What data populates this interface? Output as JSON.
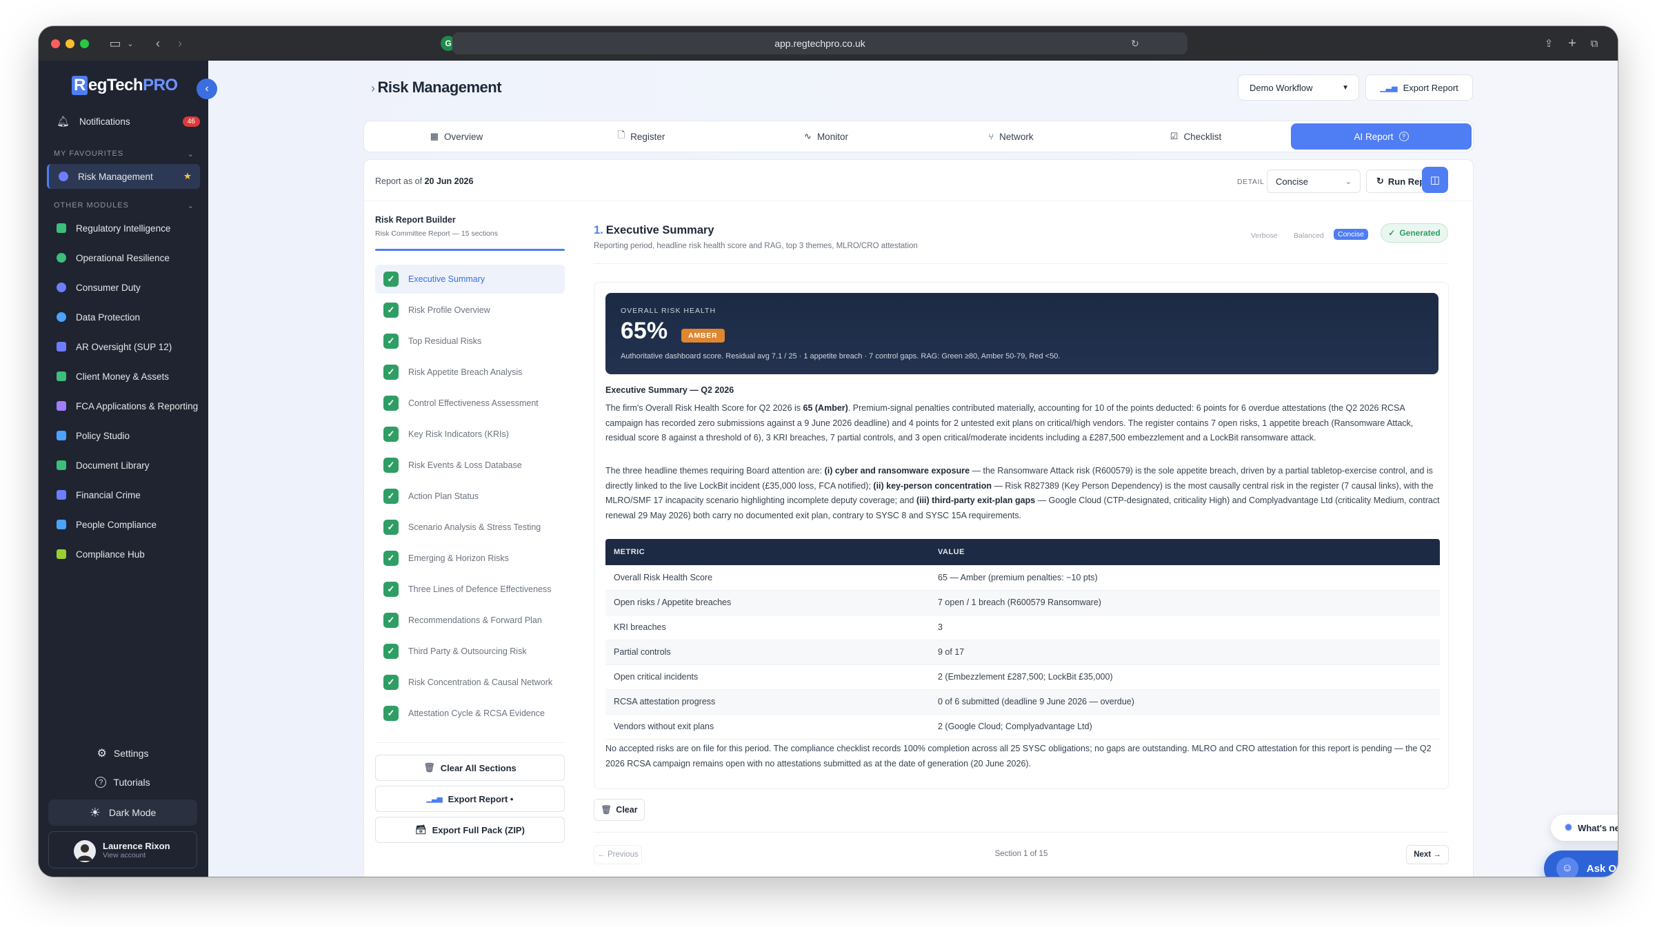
{
  "browser": {
    "url": "app.regtechpro.co.uk"
  },
  "sidebar": {
    "logo_main": "egTech",
    "logo_r": "R",
    "logo_pro": "PRO",
    "notifications_label": "Notifications",
    "notifications_count": "46",
    "favourites_header": "MY FAVOURITES",
    "favourite_item": "Risk Management",
    "favourite_star": "★",
    "other_header": "OTHER MODULES",
    "modules": [
      {
        "label": "Regulatory Intelligence",
        "color": "#3bbf7a"
      },
      {
        "label": "Operational Resilience",
        "color": "#3bbf7a"
      },
      {
        "label": "Consumer Duty",
        "color": "#6d7dff"
      },
      {
        "label": "Data Protection",
        "color": "#4aa3ff"
      },
      {
        "label": "AR Oversight (SUP 12)",
        "color": "#6d7dff"
      },
      {
        "label": "Client Money & Assets",
        "color": "#3bbf7a"
      },
      {
        "label": "FCA Applications & Reporting",
        "color": "#a07dff"
      },
      {
        "label": "Policy Studio",
        "color": "#4aa3ff"
      },
      {
        "label": "Document Library",
        "color": "#3bbf7a"
      },
      {
        "label": "Financial Crime",
        "color": "#6d7dff"
      },
      {
        "label": "People Compliance",
        "color": "#4aa3ff"
      },
      {
        "label": "Compliance Hub",
        "color": "#9acd32"
      }
    ],
    "settings_label": "Settings",
    "tutorials_label": "Tutorials",
    "darkmode_label": "Dark Mode",
    "user_name": "Laurence Rixon",
    "user_sub": "View account"
  },
  "header": {
    "breadcrumb_chevron": "›",
    "title": "Risk Management",
    "workflow_label": "Demo Workflow",
    "export_label": "Export Report"
  },
  "tabs": [
    {
      "label": "Overview",
      "icon": "grid-icon"
    },
    {
      "label": "Register",
      "icon": "document-icon"
    },
    {
      "label": "Monitor",
      "icon": "activity-icon"
    },
    {
      "label": "Network",
      "icon": "network-icon"
    },
    {
      "label": "Checklist",
      "icon": "checklist-icon"
    },
    {
      "label": "AI Report",
      "icon": "help-icon"
    }
  ],
  "report_bar": {
    "as_of_prefix": "Report as of",
    "as_of_date": "20 Jun 2026",
    "detail_label": "DETAIL",
    "detail_value": "Concise",
    "run_label": "Run Repo"
  },
  "builder": {
    "title": "Risk Report Builder",
    "subtitle": "Risk Committee Report — 15 sections",
    "sections": [
      "Executive Summary",
      "Risk Profile Overview",
      "Top Residual Risks",
      "Risk Appetite Breach Analysis",
      "Control Effectiveness Assessment",
      "Key Risk Indicators (KRIs)",
      "Risk Events & Loss Database",
      "Action Plan Status",
      "Scenario Analysis & Stress Testing",
      "Emerging & Horizon Risks",
      "Three Lines of Defence Effectiveness",
      "Recommendations & Forward Plan",
      "Third Party & Outsourcing Risk",
      "Risk Concentration & Causal Network",
      "Attestation Cycle & RCSA Evidence"
    ],
    "clear_all": "Clear All Sections",
    "export_report": "Export Report •",
    "export_pack": "Export Full Pack (ZIP)"
  },
  "section": {
    "number": "1.",
    "title": "Executive Summary",
    "subtitle": "Reporting period, headline risk health score and RAG, top 3 themes, MLRO/CRO attestation",
    "mode_verbose": "Verbose",
    "mode_balanced": "Balanced",
    "mode_concise": "Concise",
    "status": "Generated",
    "banner_label": "OVERALL RISK HEALTH",
    "score": "65%",
    "rag": "AMBER",
    "banner_desc": "Authoritative dashboard score. Residual avg 7.1 / 25 · 1 appetite breach · 7 control gaps. RAG: Green ≥80, Amber 50-79, Red <50.",
    "heading": "Executive Summary — Q2 2026",
    "p1_a": "The firm's Overall Risk Health Score for Q2 2026 is ",
    "p1_bold": "65 (Amber)",
    "p1_b": ". Premium-signal penalties contributed materially, accounting for 10 of the points deducted: 6 points for 6 overdue attestations (the Q2 2026 RCSA campaign has recorded zero submissions against a 9 June 2026 deadline) and 4 points for 2 untested exit plans on critical/high vendors. The register contains 7 open risks, 1 appetite breach (Ransomware Attack, residual score 8 against a threshold of 6), 3 KRI breaches, 7 partial controls, and 3 open critical/moderate incidents including a £287,500 embezzlement and a LockBit ransomware attack.",
    "p2_a": "The three headline themes requiring Board attention are: ",
    "p2_b1": "(i) cyber and ransomware exposure",
    "p2_b": " — the Ransomware Attack risk (R600579) is the sole appetite breach, driven by a partial tabletop-exercise control, and is directly linked to the live LockBit incident (£35,000 loss, FCA notified); ",
    "p2_b2": "(ii) key-person concentration",
    "p2_c": " — Risk R827389 (Key Person Dependency) is the most causally central risk in the register (7 causal links), with the MLRO/SMF 17 incapacity scenario highlighting incomplete deputy coverage; and ",
    "p2_b3": "(iii) third-party exit-plan gaps",
    "p2_d": " — Google Cloud (CTP-designated, criticality High) and Complyadvantage Ltd (criticality Medium, contract renewal 29 May 2026) both carry no documented exit plan, contrary to SYSC 8 and SYSC 15A requirements.",
    "table_headers": [
      "METRIC",
      "VALUE"
    ],
    "table_rows": [
      [
        "Overall Risk Health Score",
        "65 — Amber (premium penalties: −10 pts)"
      ],
      [
        "Open risks / Appetite breaches",
        "7 open / 1 breach (R600579 Ransomware)"
      ],
      [
        "KRI breaches",
        "3"
      ],
      [
        "Partial controls",
        "9 of 17"
      ],
      [
        "Open critical incidents",
        "2 (Embezzlement £287,500; LockBit £35,000)"
      ],
      [
        "RCSA attestation progress",
        "0 of 6 submitted (deadline 9 June 2026 — overdue)"
      ],
      [
        "Vendors without exit plans",
        "2 (Google Cloud; Complyadvantage Ltd)"
      ]
    ],
    "p3": "No accepted risks are on file for this period. The compliance checklist records 100% completion across all 25 SYSC obligations; no gaps are outstanding. MLRO and CRO attestation for this report is pending — the Q2 2026 RCSA campaign remains open with no attestations submitted as at the date of generation (20 June 2026).",
    "clear_label": "Clear",
    "prev_label": "← Previous",
    "pager": "Section 1 of 15",
    "next_label": "Next →"
  },
  "floating": {
    "whats_new": "What's new",
    "ask_otto": "Ask Otto"
  },
  "colors": {
    "accent": "#4f7df3",
    "sidebar_bg": "#1f2430",
    "amber": "#e0862f",
    "green": "#2f9e64",
    "navy": "#1c2a44"
  }
}
